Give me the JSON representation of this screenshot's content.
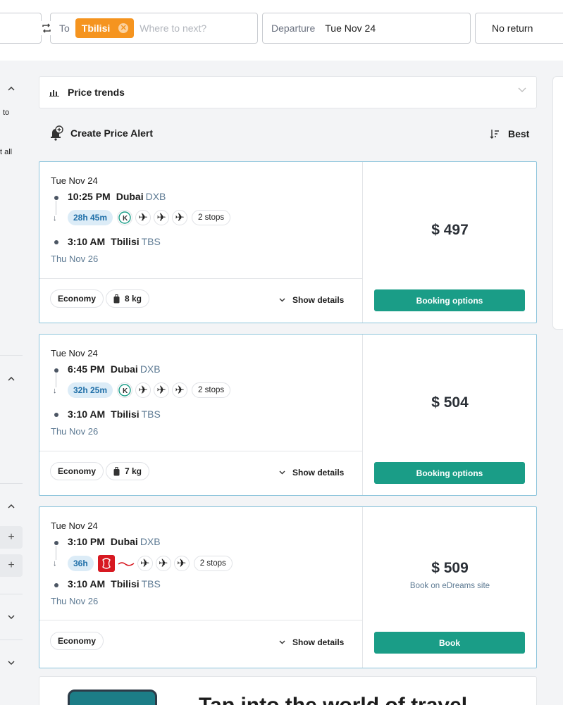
{
  "search": {
    "to_label": "To",
    "destination_chip": "Tbilisi",
    "to_placeholder": "Where to next?",
    "departure_label": "Departure",
    "departure_value": "Tue Nov 24",
    "return_value": "No return"
  },
  "sidebar": {
    "snippet_1": "to",
    "snippet_2": "t all",
    "plus_1": "+",
    "plus_2": "+"
  },
  "price_trends": {
    "label": "Price trends"
  },
  "alerts": {
    "label": "Create Price Alert"
  },
  "sort": {
    "label": "Best"
  },
  "results": [
    {
      "depart_date": "Tue Nov 24",
      "depart_time": "10:25 PM",
      "depart_city": "Dubai",
      "depart_code": "DXB",
      "duration": "28h 45m",
      "stops": "2 stops",
      "arrive_time": "3:10 AM",
      "arrive_city": "Tbilisi",
      "arrive_code": "TBS",
      "arrive_date": "Thu Nov 26",
      "cabin": "Economy",
      "bag": "8 kg",
      "details_label": "Show details",
      "price": "$ 497",
      "cta": "Booking options"
    },
    {
      "depart_date": "Tue Nov 24",
      "depart_time": "6:45 PM",
      "depart_city": "Dubai",
      "depart_code": "DXB",
      "duration": "32h 25m",
      "stops": "2 stops",
      "arrive_time": "3:10 AM",
      "arrive_city": "Tbilisi",
      "arrive_code": "TBS",
      "arrive_date": "Thu Nov 26",
      "cabin": "Economy",
      "bag": "7 kg",
      "details_label": "Show details",
      "price": "$ 504",
      "cta": "Booking options"
    },
    {
      "depart_date": "Tue Nov 24",
      "depart_time": "3:10 PM",
      "depart_city": "Dubai",
      "depart_code": "DXB",
      "duration": "36h",
      "stops": "2 stops",
      "arrive_time": "3:10 AM",
      "arrive_city": "Tbilisi",
      "arrive_code": "TBS",
      "arrive_date": "Thu Nov 26",
      "cabin": "Economy",
      "details_label": "Show details",
      "price": "$ 509",
      "price_note": "Book on eDreams site",
      "cta": "Book"
    }
  ],
  "promo": {
    "title": "Tap into the world of travel"
  },
  "colors": {
    "accent": "#1a9d87",
    "chip": "#f5941f",
    "card_border": "#8ec5dc",
    "duration_bg": "#dcecf7"
  },
  "icons": [
    "swap-icon",
    "bar-chart-icon",
    "bell-plus-icon",
    "sort-icon",
    "chevron-down-icon",
    "plane-icon",
    "airline-k-icon",
    "luggage-icon",
    "emirates-logo-icon"
  ]
}
